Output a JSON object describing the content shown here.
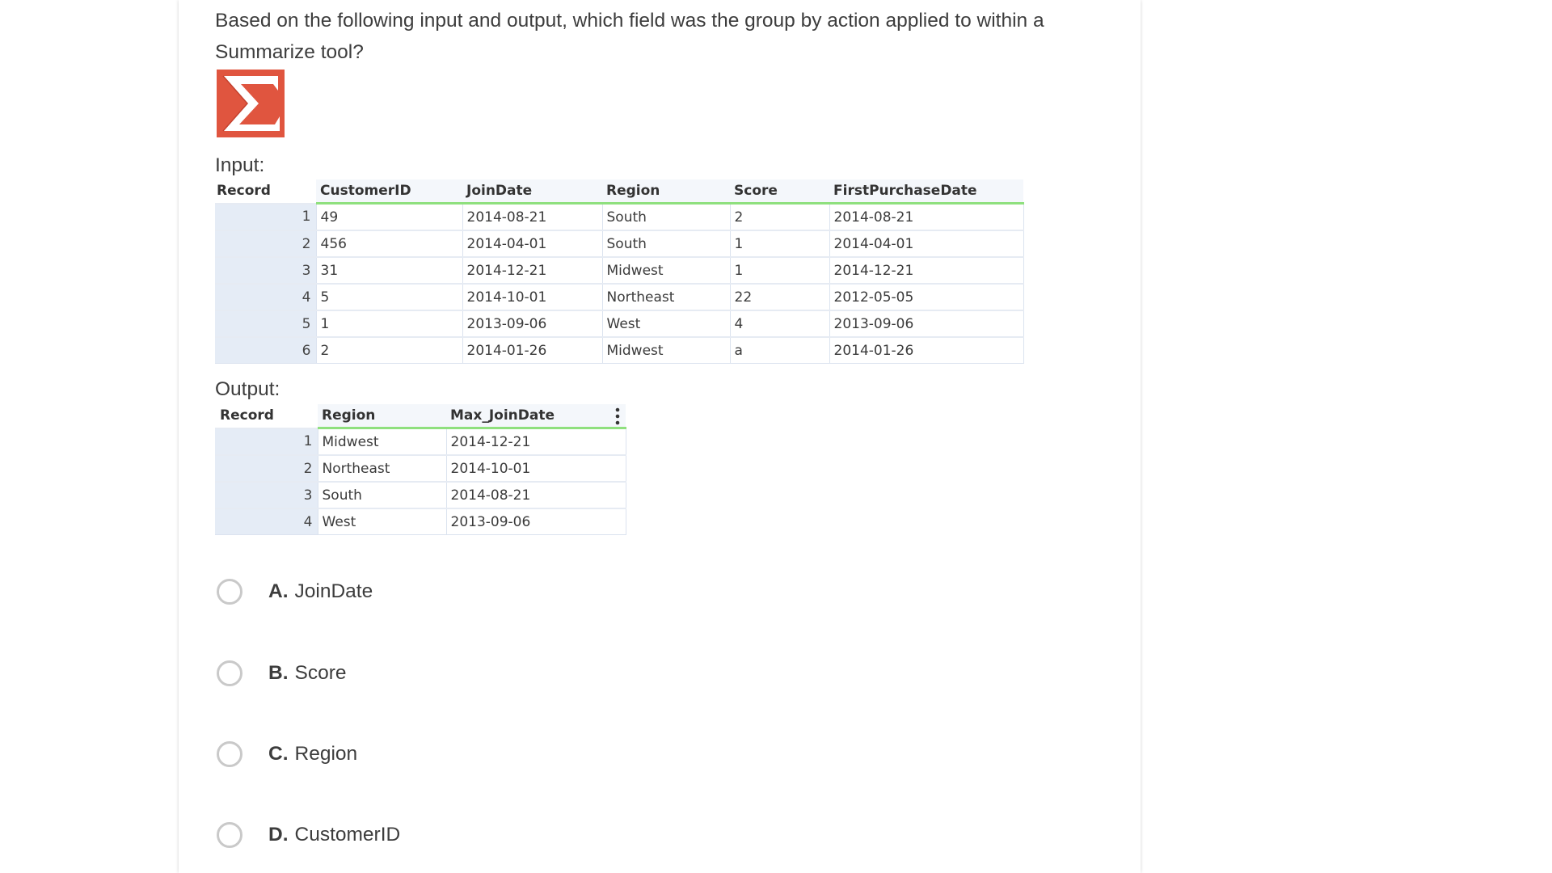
{
  "question": {
    "line1": "Based on the following input and output, which field was the group by action applied to within a",
    "line2": "Summarize tool?"
  },
  "tool_icon": {
    "name": "summarize-sigma-icon",
    "glyph": "Σ",
    "color": "#e0553f"
  },
  "input": {
    "label": "Input:",
    "headers": [
      "Record",
      "CustomerID",
      "JoinDate",
      "Region",
      "Score",
      "FirstPurchaseDate"
    ],
    "rows": [
      [
        "1",
        "49",
        "2014-08-21",
        "South",
        "2",
        "2014-08-21"
      ],
      [
        "2",
        "456",
        "2014-04-01",
        "South",
        "1",
        "2014-04-01"
      ],
      [
        "3",
        "31",
        "2014-12-21",
        "Midwest",
        "1",
        "2014-12-21"
      ],
      [
        "4",
        "5",
        "2014-10-01",
        "Northeast",
        "22",
        "2012-05-05"
      ],
      [
        "5",
        "1",
        "2013-09-06",
        "West",
        "4",
        "2013-09-06"
      ],
      [
        "6",
        "2",
        "2014-01-26",
        "Midwest",
        "a",
        "2014-01-26"
      ]
    ]
  },
  "output": {
    "label": "Output:",
    "headers": [
      "Record",
      "Region",
      "Max_JoinDate"
    ],
    "rows": [
      [
        "1",
        "Midwest",
        "2014-12-21"
      ],
      [
        "2",
        "Northeast",
        "2014-10-01"
      ],
      [
        "3",
        "South",
        "2014-08-21"
      ],
      [
        "4",
        "West",
        "2013-09-06"
      ]
    ]
  },
  "options": [
    {
      "letter": "A.",
      "text": "JoinDate"
    },
    {
      "letter": "B.",
      "text": "Score"
    },
    {
      "letter": "C.",
      "text": "Region"
    },
    {
      "letter": "D.",
      "text": "CustomerID"
    }
  ],
  "colors": {
    "header_underline": "#8fe07e",
    "record_cell_bg": "#e5ecf6",
    "radio_border": "#c9c9c9"
  }
}
